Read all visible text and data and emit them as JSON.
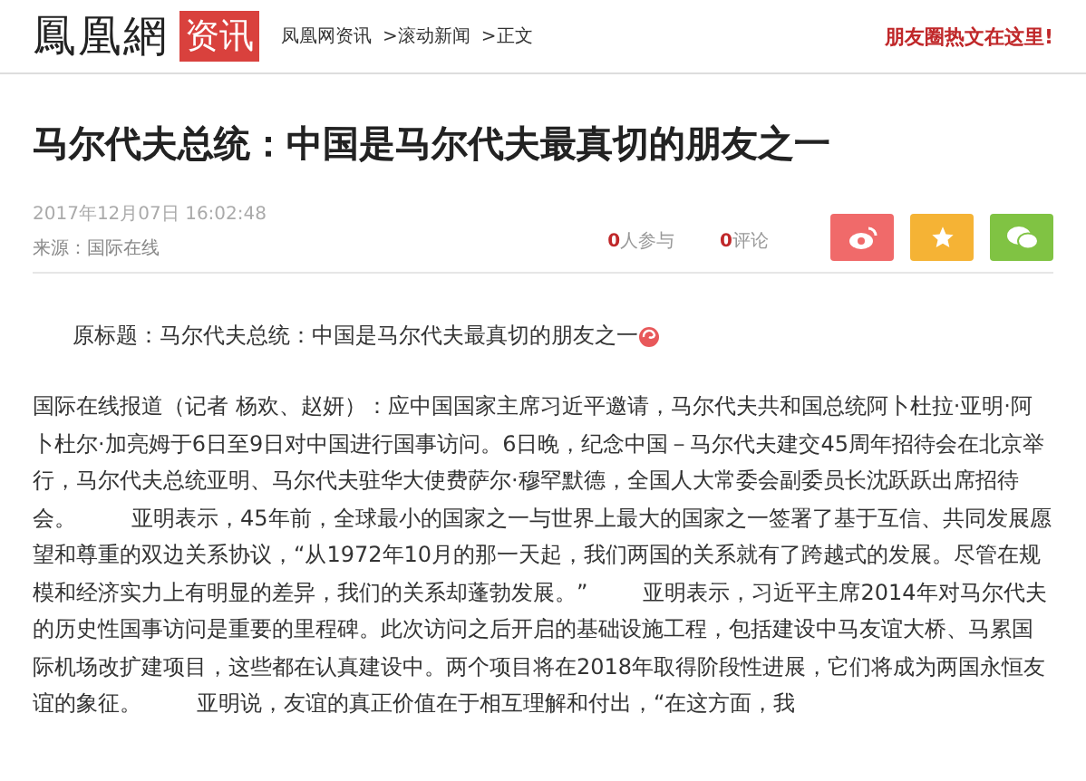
{
  "header": {
    "logo": "鳳凰網",
    "channel": "资讯",
    "breadcrumbs": [
      "凤凰网资讯",
      ">滚动新闻",
      ">正文"
    ],
    "promo": "朋友圈热文在这里!"
  },
  "article": {
    "title": "马尔代夫总统：中国是马尔代夫最真切的朋友之一",
    "date": "2017年12月07日  16:02:48",
    "source": "来源：国际在线",
    "stats": [
      {
        "count": "0",
        "label": "人参与"
      },
      {
        "count": "0",
        "label": "评论"
      }
    ],
    "share": [
      {
        "kind": "weibo",
        "color": "#f06a6a"
      },
      {
        "kind": "favorite",
        "color": "#f5b335"
      },
      {
        "kind": "wechat",
        "color": "#80c343"
      }
    ],
    "original_title": "原标题：马尔代夫总统：中国是马尔代夫最真切的朋友之一",
    "body": "国际在线报道（记者 杨欢、赵妍）：应中国国家主席习近平邀请，马尔代夫共和国总统阿卜杜拉·亚明·阿卜杜尔·加亮姆于6日至9日对中国进行国事访问。6日晚，纪念中国－马尔代夫建交45周年招待会在北京举行，马尔代夫总统亚明、马尔代夫驻华大使费萨尔·穆罕默德，全国人大常委会副委员长沈跃跃出席招待会。        亚明表示，45年前，全球最小的国家之一与世界上最大的国家之一签署了基于互信、共同发展愿望和尊重的双边关系协议，“从1972年10月的那一天起，我们两国的关系就有了跨越式的发展。尽管在规模和经济实力上有明显的差异，我们的关系却蓬勃发展。”        亚明表示，习近平主席2014年对马尔代夫的历史性国事访问是重要的里程碑。此次访问之后开启的基础设施工程，包括建设中马友谊大桥、马累国际机场改扩建项目，这些都在认真建设中。两个项目将在2018年取得阶段性进展，它们将成为两国永恒友谊的象征。        亚明说，友谊的真正价值在于相互理解和付出，“在这方面，我"
  }
}
